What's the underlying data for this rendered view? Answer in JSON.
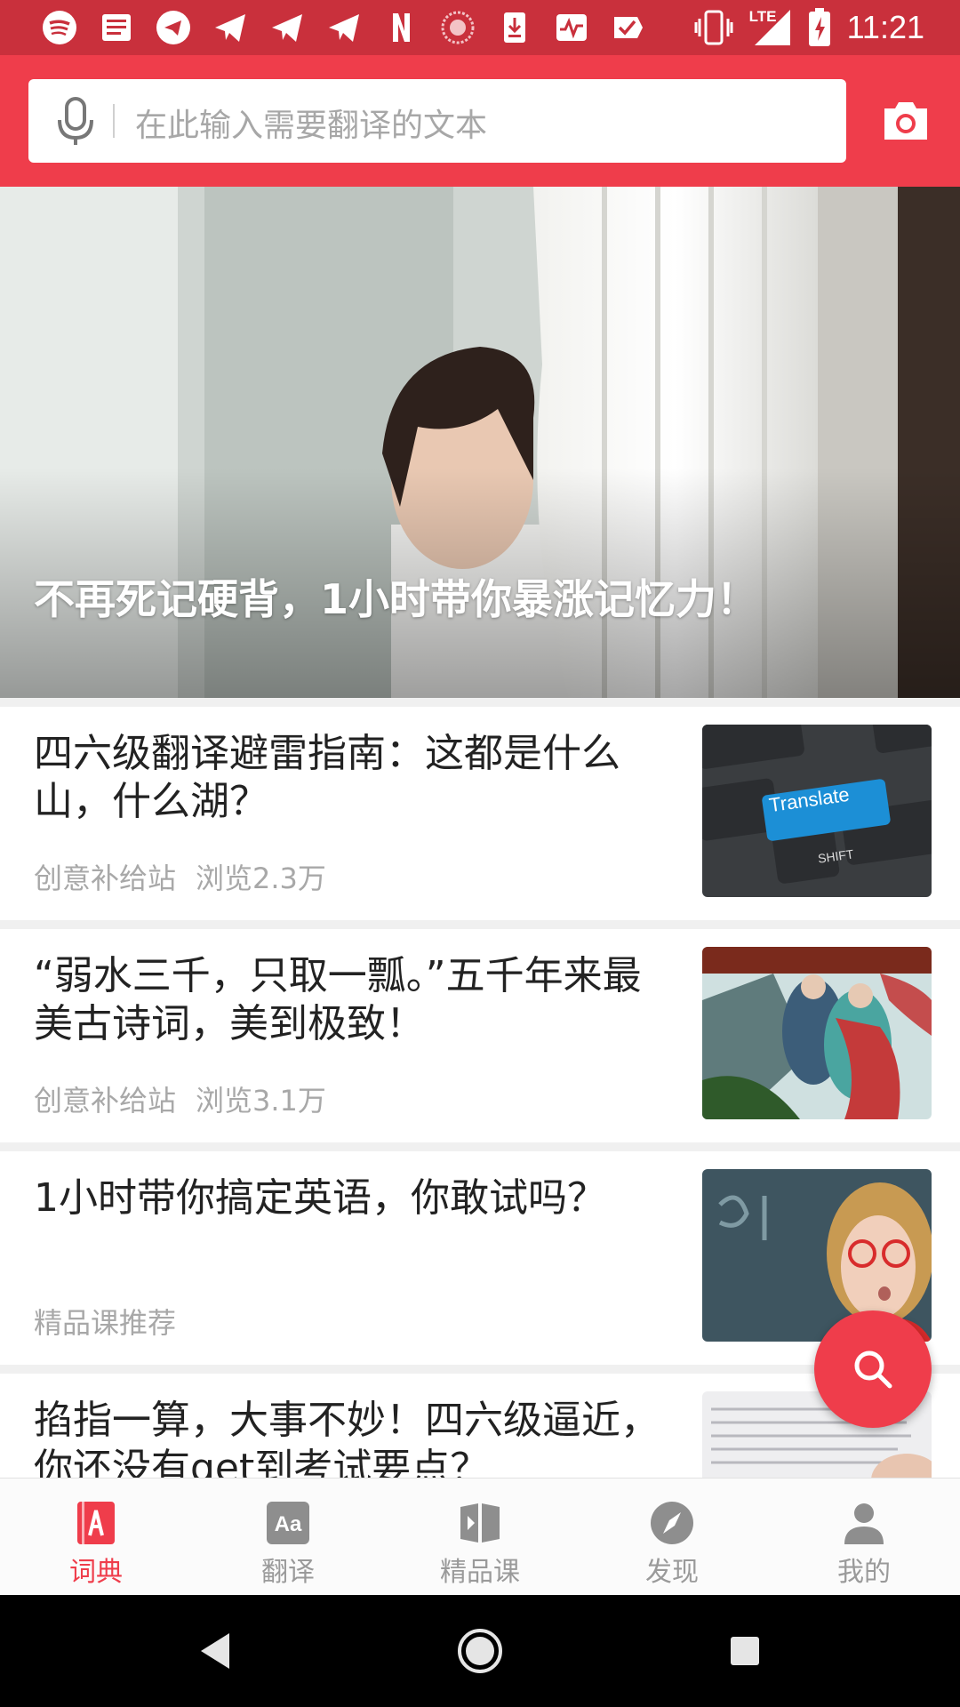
{
  "status_bar": {
    "time": "11:21",
    "network_label": "LTE",
    "icons": [
      "spotify-icon",
      "news-icon",
      "telegram-icon",
      "telegram-icon",
      "telegram-icon",
      "telegram-icon",
      "netflix-icon",
      "pokeball-icon",
      "download-icon",
      "activity-icon",
      "check-icon"
    ]
  },
  "search": {
    "placeholder": "在此输入需要翻译的文本"
  },
  "hero": {
    "title": "不再死记硬背，1小时带你暴涨记忆力！"
  },
  "articles": [
    {
      "title": "四六级翻译避雷指南：这都是什么山，什么湖？",
      "source": "创意补给站",
      "views": "浏览2.3万",
      "thumb_label": "Translate",
      "thumb_key": "SHIFT"
    },
    {
      "title": "“弱水三千，只取一瓢。”五千年来最美古诗词，美到极致！",
      "source": "创意补给站",
      "views": "浏览3.1万"
    },
    {
      "title": "1小时带你搞定英语，你敢试吗？",
      "source": "精品课推荐",
      "views": ""
    },
    {
      "title": "掐指一算，大事不妙！四六级逼近，你还没有get到考试要点？",
      "source": "",
      "views": ""
    }
  ],
  "bottom_nav": [
    {
      "label": "词典",
      "icon": "dictionary-icon",
      "active": true
    },
    {
      "label": "翻译",
      "icon": "translate-icon",
      "active": false
    },
    {
      "label": "精品课",
      "icon": "course-icon",
      "active": false
    },
    {
      "label": "发现",
      "icon": "compass-icon",
      "active": false
    },
    {
      "label": "我的",
      "icon": "profile-icon",
      "active": false
    }
  ],
  "colors": {
    "accent": "#ef3d4b",
    "status_bar": "#c9303c",
    "inactive": "#9a9a9a"
  }
}
